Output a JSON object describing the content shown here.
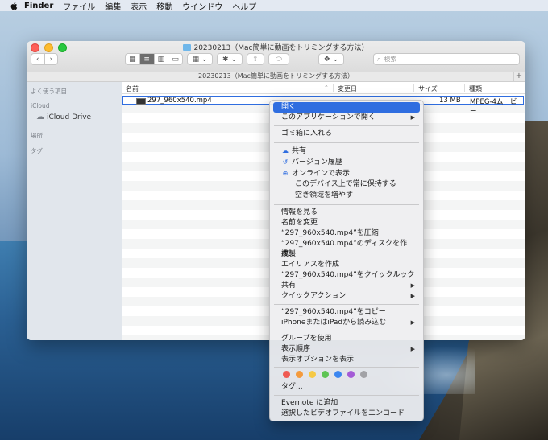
{
  "menubar": {
    "app": "Finder",
    "items": [
      "ファイル",
      "編集",
      "表示",
      "移動",
      "ウインドウ",
      "ヘルプ"
    ]
  },
  "window": {
    "title": "20230213（Mac簡単に動画をトリミングする方法）",
    "path_title": "20230213（Mac簡単に動画をトリミングする方法）",
    "search_placeholder": "検索"
  },
  "sidebar": {
    "favorites_label": "よく使う項目",
    "icloud_label": "iCloud",
    "icloud_drive": "iCloud Drive",
    "locations_label": "場所",
    "tags_label": "タグ"
  },
  "columns": {
    "name": "名前",
    "date": "変更日",
    "size": "サイズ",
    "kind": "種類"
  },
  "file": {
    "name": "297_960x540.mp4",
    "size": "13 MB",
    "kind": "MPEG-4ムービー"
  },
  "context_menu": {
    "open": "開く",
    "open_with": "このアプリケーションで開く",
    "move_to_trash": "ゴミ箱に入れる",
    "share_icloud": "共有",
    "version_history": "バージョン履歴",
    "show_online": "オンラインで表示",
    "keep_on_device": "このデバイス上で常に保持する",
    "free_up_space": "空き領域を増やす",
    "get_info": "情報を見る",
    "rename": "名前を変更",
    "compress": "“297_960x540.mp4”を圧縮",
    "burn": "“297_960x540.mp4”のディスクを作成...",
    "duplicate": "複製",
    "make_alias": "エイリアスを作成",
    "quick_look": "“297_960x540.mp4”をクイックルック",
    "share": "共有",
    "quick_actions": "クイックアクション",
    "copy": "“297_960x540.mp4”をコピー",
    "import_iphone": "iPhoneまたはiPadから読み込む",
    "use_groups": "グループを使用",
    "sort_by": "表示順序",
    "show_view_options": "表示オプションを表示",
    "tags": "タグ...",
    "evernote": "Evernote に追加",
    "encode_video": "選択したビデオファイルをエンコード",
    "tag_colors": [
      "#ef5a52",
      "#f49a3c",
      "#f6c945",
      "#5ec454",
      "#3b86f0",
      "#a45bd6",
      "#a2a2a6"
    ]
  }
}
